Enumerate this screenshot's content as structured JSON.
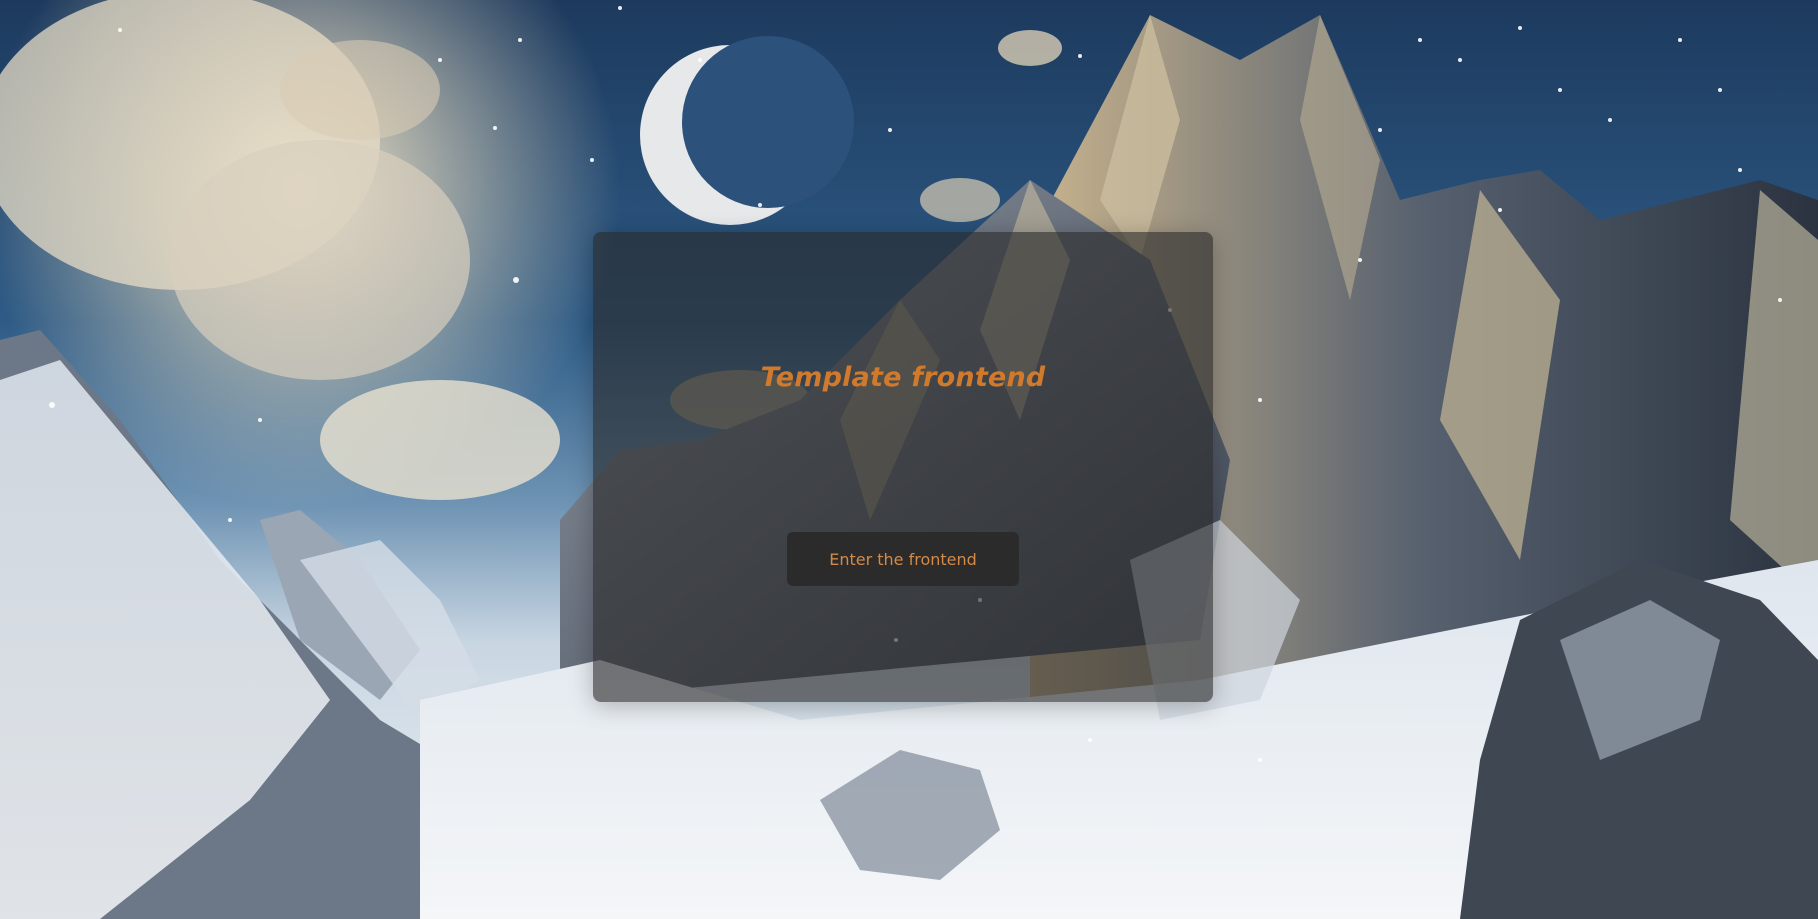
{
  "page": {
    "title": "Template frontend",
    "enter_button_label": "Enter the frontend"
  },
  "colors": {
    "accent": "#d27a2c",
    "button_bg": "#2b2b2b",
    "card_bg": "#282828"
  },
  "background": {
    "description_icon": "snowy-mountains-crescent-moon-background"
  }
}
